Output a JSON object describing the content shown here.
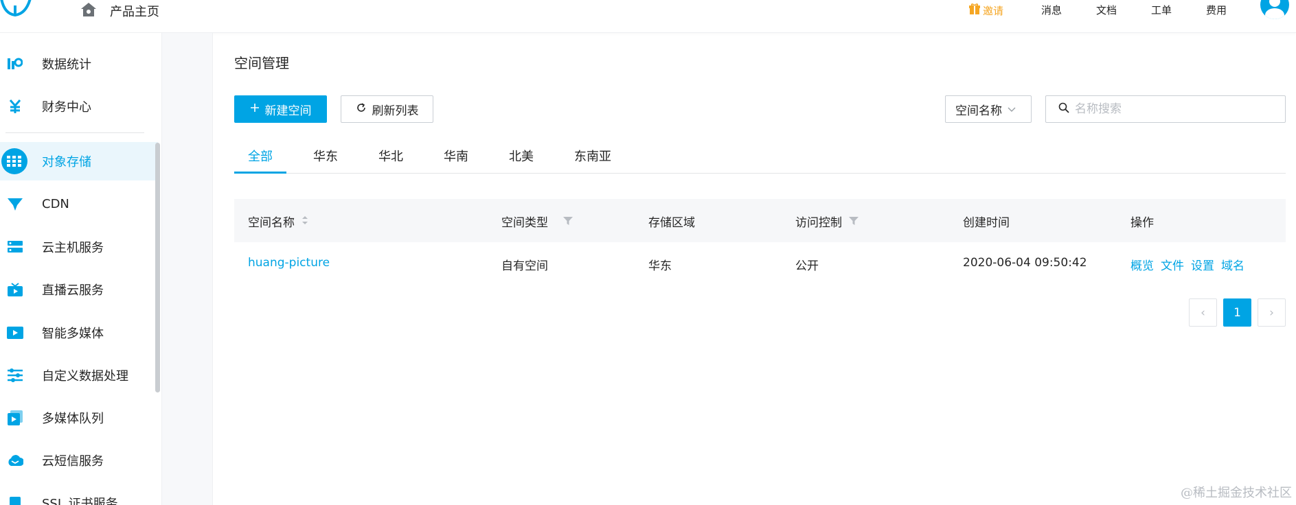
{
  "header": {
    "home_label": "产品主页",
    "invite_label": "邀请",
    "messages_label": "消息",
    "docs_label": "文档",
    "tickets_label": "工单",
    "billing_label": "费用"
  },
  "sidebar": {
    "items": [
      {
        "label": "数据统计",
        "icon": "stats-icon"
      },
      {
        "label": "财务中心",
        "icon": "yuan-icon"
      },
      {
        "label": "对象存储",
        "icon": "object-storage-icon",
        "active": true
      },
      {
        "label": "CDN",
        "icon": "cdn-icon"
      },
      {
        "label": "云主机服务",
        "icon": "server-icon"
      },
      {
        "label": "直播云服务",
        "icon": "tv-icon"
      },
      {
        "label": "智能多媒体",
        "icon": "video-icon"
      },
      {
        "label": "自定义数据处理",
        "icon": "sliders-icon"
      },
      {
        "label": "多媒体队列",
        "icon": "media-queue-icon"
      },
      {
        "label": "云短信服务",
        "icon": "cloud-sms-icon"
      },
      {
        "label": "SSL 证书服务",
        "icon": "ssl-icon"
      }
    ]
  },
  "main": {
    "title": "空间管理",
    "new_button": "新建空间",
    "refresh_button": "刷新列表",
    "filter_select": "空间名称",
    "search_placeholder": "名称搜索",
    "tabs": [
      "全部",
      "华东",
      "华北",
      "华南",
      "北美",
      "东南亚"
    ],
    "table": {
      "columns": [
        "空间名称",
        "空间类型",
        "存储区域",
        "访问控制",
        "创建时间",
        "操作"
      ],
      "rows": [
        {
          "name": "huang-picture",
          "type": "自有空间",
          "region": "华东",
          "access": "公开",
          "created": "2020-06-04 09:50:42",
          "actions": [
            "概览",
            "文件",
            "设置",
            "域名"
          ]
        }
      ]
    },
    "pagination": {
      "current": "1",
      "prev": "‹",
      "next": "›"
    }
  },
  "watermark": "@稀土掘金技术社区",
  "colors": {
    "accent": "#00a4e4",
    "invite": "#f5a623"
  }
}
